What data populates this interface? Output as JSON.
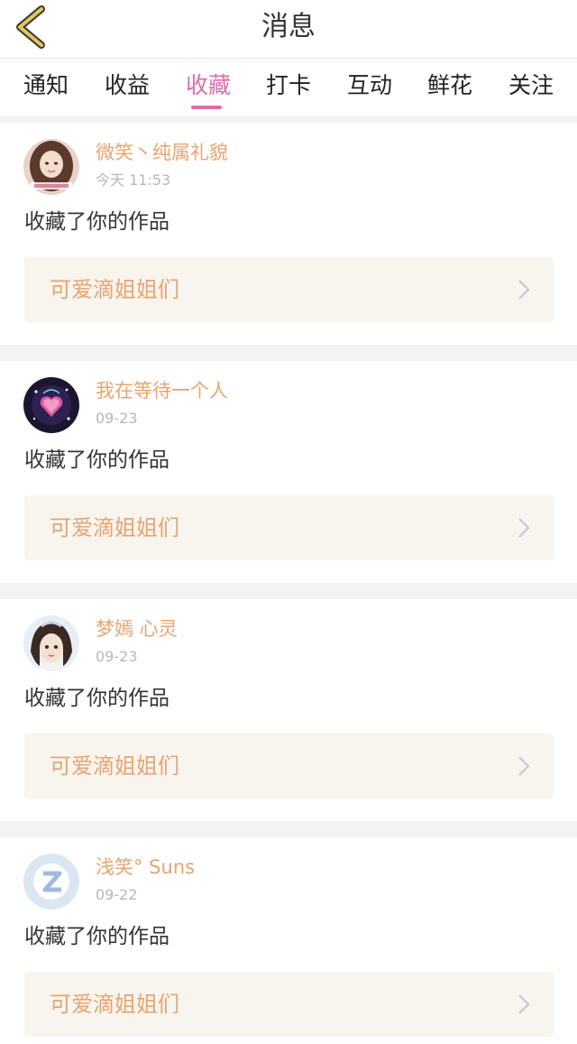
{
  "header": {
    "title": "消息"
  },
  "tabs": [
    {
      "label": "通知"
    },
    {
      "label": "收益"
    },
    {
      "label": "收藏",
      "active": true
    },
    {
      "label": "打卡"
    },
    {
      "label": "互动"
    },
    {
      "label": "鲜花"
    },
    {
      "label": "关注"
    }
  ],
  "messages": [
    {
      "user": "微笑丶纯属礼貌",
      "time": "今天 11:53",
      "action": "收藏了你的作品",
      "work": "可爱滴姐姐们",
      "avatar_icon": "girl-photo-avatar-icon"
    },
    {
      "user": "我在等待一个人",
      "time": "09-23",
      "action": "收藏了你的作品",
      "work": "可爱滴姐姐们",
      "avatar_icon": "heart-pattern-avatar-icon"
    },
    {
      "user": "梦嫣 心灵",
      "time": "09-23",
      "action": "收藏了你的作品",
      "work": "可爱滴姐姐们",
      "avatar_icon": "cartoon-girl-avatar-icon"
    },
    {
      "user": "浅笑° Suns",
      "time": "09-22",
      "action": "收藏了你的作品",
      "work": "可爱滴姐姐们",
      "avatar_icon": "default-avatar-icon"
    }
  ],
  "colors": {
    "accent": "#e26bad",
    "username": "#e8a472",
    "work_bg": "#f7f5ee",
    "back_icon": "#d9b94a"
  }
}
